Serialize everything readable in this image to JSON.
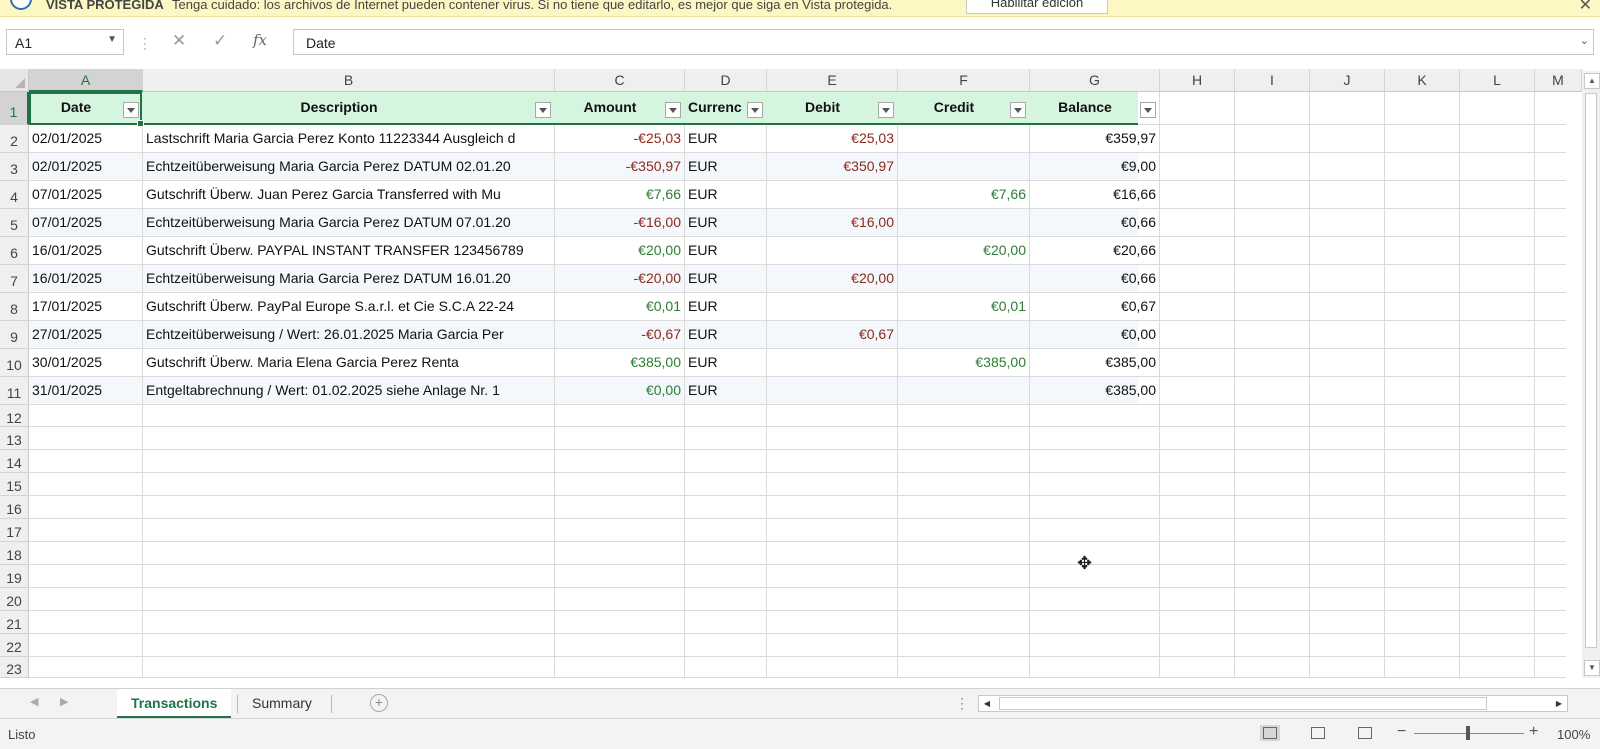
{
  "protected_view": {
    "title": "VISTA PROTEGIDA",
    "message": "Tenga cuidado: los archivos de Internet pueden contener virus. Si no tiene que editarlo, es mejor que siga en Vista protegida.",
    "enable_button": "Habilitar edición"
  },
  "formula_bar": {
    "name_box": "A1",
    "cancel_icon": "✕",
    "enter_icon": "✓",
    "fx_label": "fx",
    "value": "Date"
  },
  "columns": [
    "A",
    "B",
    "C",
    "D",
    "E",
    "F",
    "G",
    "H",
    "I",
    "J",
    "K",
    "L",
    "M"
  ],
  "rows": [
    "1",
    "2",
    "3",
    "4",
    "5",
    "6",
    "7",
    "8",
    "9",
    "10",
    "11",
    "12",
    "13",
    "14",
    "15",
    "16",
    "17",
    "18",
    "19",
    "20",
    "21",
    "22",
    "23"
  ],
  "table": {
    "headers": [
      "Date",
      "Description",
      "Amount",
      "Currenc",
      "Debit",
      "Credit",
      "Balance"
    ],
    "rows": [
      {
        "date": "02/01/2025",
        "description": "Lastschrift Maria Garcia Perez Konto 11223344 Ausgleich d",
        "amount": "-€25,03",
        "currency": "EUR",
        "debit": "€25,03",
        "credit": "",
        "balance": "€359,97"
      },
      {
        "date": "02/01/2025",
        "description": "Echtzeitüberweisung Maria Garcia Perez DATUM 02.01.20",
        "amount": "-€350,97",
        "currency": "EUR",
        "debit": "€350,97",
        "credit": "",
        "balance": "€9,00"
      },
      {
        "date": "07/01/2025",
        "description": "Gutschrift Überw. Juan Perez Garcia Transferred with Mu",
        "amount": "€7,66",
        "currency": "EUR",
        "debit": "",
        "credit": "€7,66",
        "balance": "€16,66"
      },
      {
        "date": "07/01/2025",
        "description": "Echtzeitüberweisung Maria Garcia Perez DATUM 07.01.20",
        "amount": "-€16,00",
        "currency": "EUR",
        "debit": "€16,00",
        "credit": "",
        "balance": "€0,66"
      },
      {
        "date": "16/01/2025",
        "description": "Gutschrift Überw. PAYPAL INSTANT TRANSFER 123456789",
        "amount": "€20,00",
        "currency": "EUR",
        "debit": "",
        "credit": "€20,00",
        "balance": "€20,66"
      },
      {
        "date": "16/01/2025",
        "description": "Echtzeitüberweisung Maria Garcia Perez DATUM 16.01.20",
        "amount": "-€20,00",
        "currency": "EUR",
        "debit": "€20,00",
        "credit": "",
        "balance": "€0,66"
      },
      {
        "date": "17/01/2025",
        "description": "Gutschrift Überw. PayPal Europe S.a.r.l. et Cie S.C.A 22-24",
        "amount": "€0,01",
        "currency": "EUR",
        "debit": "",
        "credit": "€0,01",
        "balance": "€0,67"
      },
      {
        "date": "27/01/2025",
        "description": "Echtzeitüberweisung / Wert: 26.01.2025 Maria Garcia Per",
        "amount": "-€0,67",
        "currency": "EUR",
        "debit": "€0,67",
        "credit": "",
        "balance": "€0,00"
      },
      {
        "date": "30/01/2025",
        "description": "Gutschrift Überw. Maria Elena Garcia Perez Renta",
        "amount": "€385,00",
        "currency": "EUR",
        "debit": "",
        "credit": "€385,00",
        "balance": "€385,00"
      },
      {
        "date": "31/01/2025",
        "description": "Entgeltabrechnung / Wert: 01.02.2025 siehe Anlage Nr. 1",
        "amount": "€0,00",
        "currency": "EUR",
        "debit": "",
        "credit": "",
        "balance": "€385,00"
      }
    ]
  },
  "sheets": [
    {
      "name": "Transactions",
      "active": true
    },
    {
      "name": "Summary",
      "active": false
    }
  ],
  "status": {
    "text": "Listo",
    "zoom": "100%",
    "zoom_level": 100
  },
  "colors": {
    "accent": "#217346",
    "header_fill": "#d6f5df",
    "negative": "#8b2a1d",
    "positive": "#2e7d32",
    "banner": "#fdf7c3"
  }
}
